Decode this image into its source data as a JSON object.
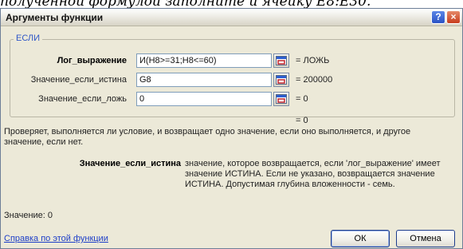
{
  "document": {
    "caption": "полученной формулой заполните и ячейку Е8:Е30."
  },
  "dialog": {
    "title": "Аргументы функции",
    "help_button": "?",
    "close_button": "×"
  },
  "group": {
    "caption": "ЕСЛИ"
  },
  "arguments": [
    {
      "label": "Лог_выражение",
      "value": "И(Н8>=31;Н8<=60)",
      "result": "= ЛОЖЬ"
    },
    {
      "label": "Значение_если_истина",
      "value": "G8",
      "result": "= 200000"
    },
    {
      "label": "Значение_если_ложь",
      "value": "0",
      "result": "= 0"
    }
  ],
  "formula_result": "= 0",
  "description": "Проверяет, выполняется ли условие, и возвращает одно значение, если оно выполняется, и другое значение, если нет.",
  "arg_help": {
    "name": "Значение_если_истина",
    "text": "значение, которое возвращается, если 'лог_выражение' имеет значение ИСТИНА. Если не указано, возвращается значение ИСТИНА. Допустимая глубина вложенности - семь."
  },
  "value_line": "Значение:  0",
  "help_link": "Справка по этой функции",
  "buttons": {
    "ok": "ОК",
    "cancel": "Отмена"
  },
  "icons": {
    "help": "question-icon",
    "close": "close-icon",
    "ref": "range-selector-icon"
  }
}
